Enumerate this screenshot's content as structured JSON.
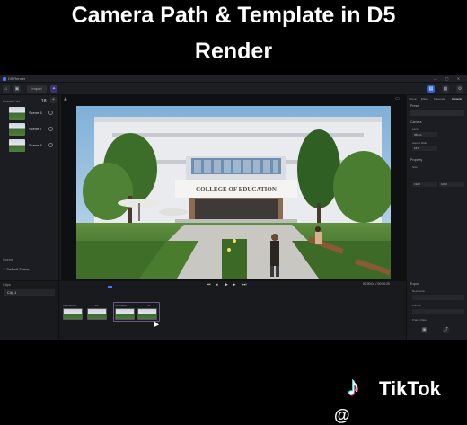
{
  "caption": {
    "line1": "Camera Path & Template in D5",
    "line2": "Render"
  },
  "window": {
    "title": "D5 Render"
  },
  "toolbar": {
    "import_label": "Import"
  },
  "left_panel": {
    "section_title": "Scene List",
    "count": "18",
    "cameras": [
      {
        "label": "Scene 6"
      },
      {
        "label": "Scene 7"
      },
      {
        "label": "Scene 8"
      }
    ],
    "scene_section": "Scene",
    "scene_item": "Default Scene"
  },
  "viewport": {
    "building_sign": "COLLEGE OF EDUCATION"
  },
  "right_panel": {
    "tabs": [
      "Scene",
      "Effect",
      "Materials",
      "Camera"
    ],
    "sections": {
      "preset": "Preset",
      "camera": "Camera",
      "property": "Property",
      "export": "Export"
    },
    "fields": {
      "lens": "Lens",
      "lens_value": "35mm",
      "aspect": "Aspect Ratio",
      "aspect_value": "16:9",
      "size": "Size",
      "width": "1920",
      "height": "1080",
      "resolution": "Resolution",
      "format": "Format",
      "frame_rate": "Frame Rate"
    }
  },
  "timeline": {
    "clips_title": "Clips",
    "clip_item": "Clip 1",
    "timecode": "00:00:04 / 00:00:20",
    "keyframe_labels": [
      "Keyframe 1",
      "2s",
      "Keyframe 2",
      "5s"
    ]
  },
  "watermark": {
    "brand": "TikTok",
    "handle_fragment": "@ "
  }
}
